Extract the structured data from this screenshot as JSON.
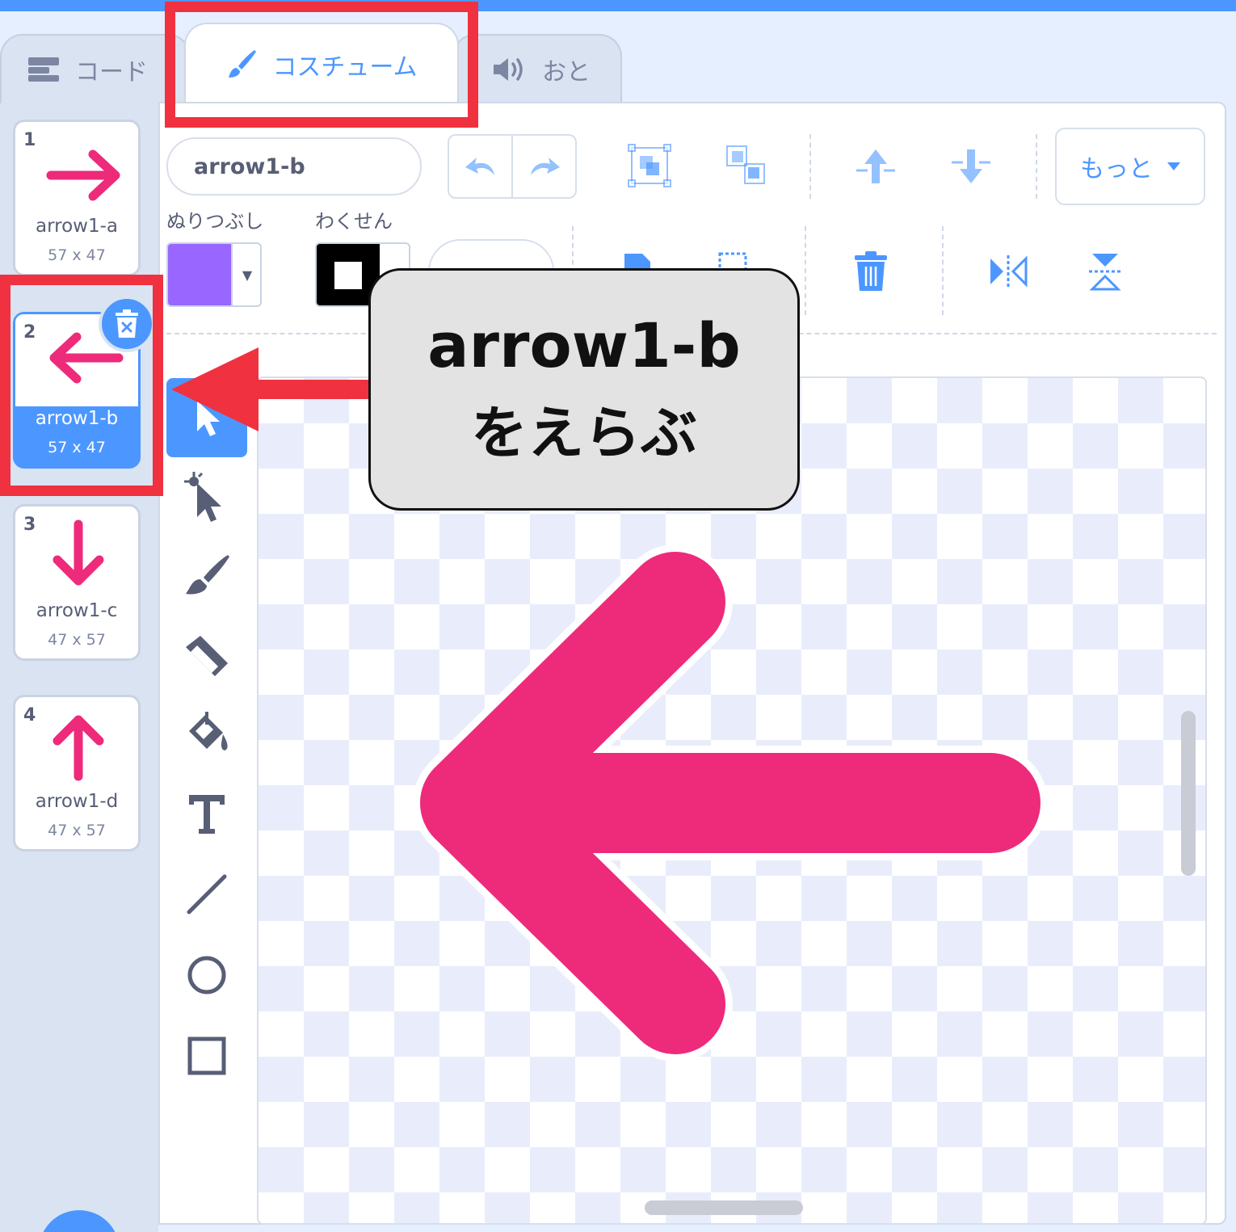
{
  "tabs": {
    "code": "コード",
    "costume": "コスチューム",
    "sound": "おと"
  },
  "costumes": [
    {
      "index": "1",
      "name": "arrow1-a",
      "size": "57 x 47",
      "direction": "right"
    },
    {
      "index": "2",
      "name": "arrow1-b",
      "size": "57 x 47",
      "direction": "left",
      "selected": true
    },
    {
      "index": "3",
      "name": "arrow1-c",
      "size": "47 x 57",
      "direction": "down"
    },
    {
      "index": "4",
      "name": "arrow1-d",
      "size": "47 x 57",
      "direction": "up"
    }
  ],
  "editor": {
    "costume_name": "arrow1-b",
    "fill_label": "ぬりつぶし",
    "outline_label": "わくせん",
    "more_label": "もっと",
    "fill_color": "#9966ff",
    "outline_color": "#000000",
    "toolbar_icons": [
      "undo-icon",
      "redo-icon",
      "group-icon",
      "ungroup-icon",
      "forward-icon",
      "backward-icon",
      "paste-icon",
      "copy-icon",
      "delete-icon",
      "flip-horizontal-icon",
      "flip-vertical-icon"
    ],
    "tools": [
      "select-icon",
      "reshape-icon",
      "brush-icon",
      "eraser-icon",
      "fill-icon",
      "text-icon",
      "line-icon",
      "circle-icon",
      "rectangle-icon"
    ]
  },
  "canvas": {
    "shape": "left-arrow",
    "color": "#ee2a7b"
  },
  "annotation": {
    "line1": "arrow1-b",
    "line2": "をえらぶ",
    "highlight_color": "#f0313f"
  },
  "colors": {
    "accent": "#4c97ff",
    "arrow_pink": "#ee2a7b"
  }
}
